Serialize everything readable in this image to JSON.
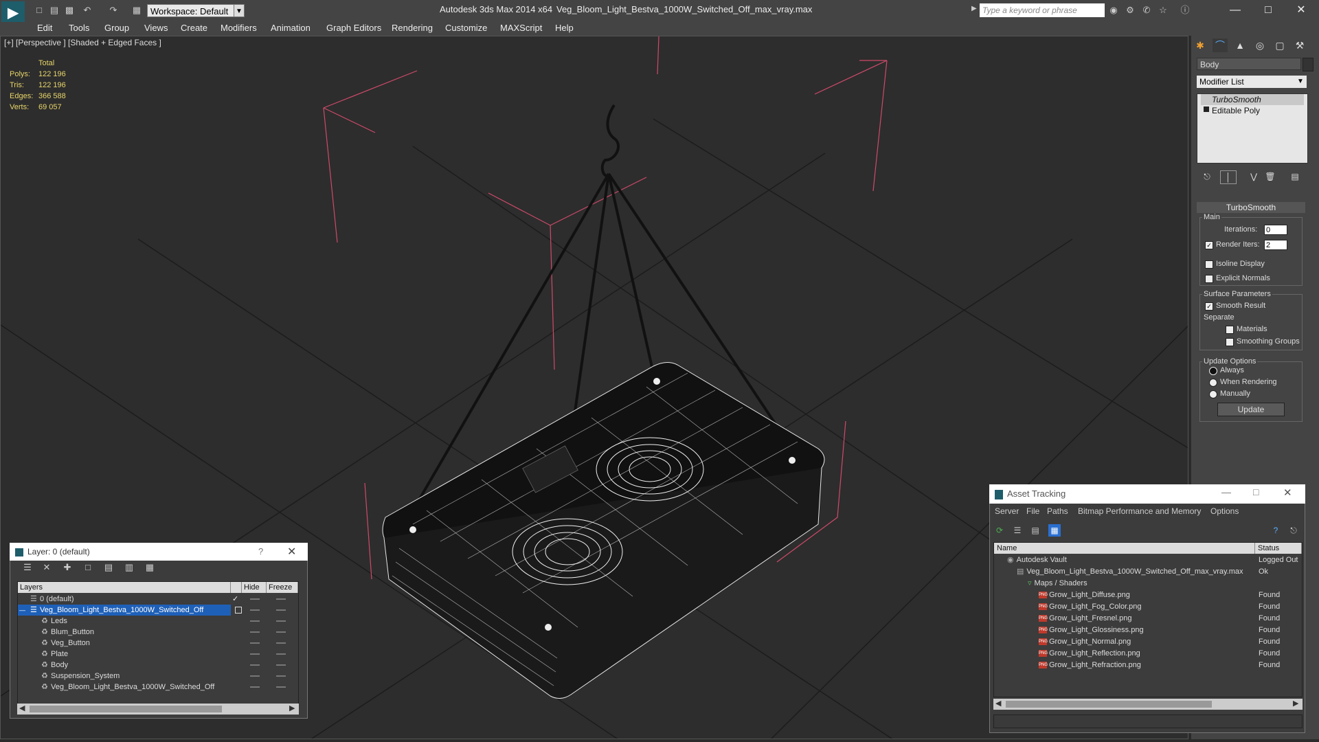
{
  "titlebar": {
    "app_title": "Autodesk 3ds Max  2014 x64",
    "file_title": "Veg_Bloom_Light_Bestva_1000W_Switched_Off_max_vray.max",
    "workspace": "Workspace: Default",
    "search_placeholder": "Type a keyword or phrase"
  },
  "menu": [
    "Edit",
    "Tools",
    "Group",
    "Views",
    "Create",
    "Modifiers",
    "Animation",
    "Graph Editors",
    "Rendering",
    "Customize",
    "MAXScript",
    "Help"
  ],
  "viewport": {
    "label": "[+] [Perspective ] [Shaded + Edged Faces ]",
    "stats": {
      "header": "Total",
      "rows": [
        {
          "label": "Polys:",
          "value": "122 196"
        },
        {
          "label": "Tris:",
          "value": "122 196"
        },
        {
          "label": "Edges:",
          "value": "366 588"
        },
        {
          "label": "Verts:",
          "value": "69 057"
        }
      ]
    }
  },
  "command_panel": {
    "object_name": "Body",
    "modifier_list": "Modifier List",
    "stack": [
      "TurboSmooth",
      "Editable Poly"
    ],
    "turbosmooth": {
      "title": "TurboSmooth",
      "main": "Main",
      "iterations_label": "Iterations:",
      "iterations_value": "0",
      "render_iters_label": "Render Iters:",
      "render_iters_value": "2",
      "isoline": "Isoline Display",
      "explicit_normals": "Explicit Normals",
      "surface_params": "Surface Parameters",
      "smooth_result": "Smooth Result",
      "separate": "Separate",
      "materials": "Materials",
      "smoothing_groups": "Smoothing Groups",
      "update_options": "Update Options",
      "always": "Always",
      "when_rendering": "When Rendering",
      "manually": "Manually",
      "update": "Update"
    }
  },
  "layer_dialog": {
    "title": "Layer: 0 (default)",
    "help": "?",
    "columns": [
      "Layers",
      "Hide",
      "Freeze"
    ],
    "rows": [
      {
        "name": "0 (default)"
      },
      {
        "name": "Veg_Bloom_Light_Bestva_1000W_Switched_Off"
      },
      {
        "name": "Leds"
      },
      {
        "name": "Blum_Button"
      },
      {
        "name": "Veg_Button"
      },
      {
        "name": "Plate"
      },
      {
        "name": "Body"
      },
      {
        "name": "Suspension_System"
      },
      {
        "name": "Veg_Bloom_Light_Bestva_1000W_Switched_Off"
      }
    ]
  },
  "asset_tracking": {
    "title": "Asset Tracking",
    "menu": [
      "Server",
      "File",
      "Paths",
      "Bitmap Performance and Memory",
      "Options"
    ],
    "columns": [
      "Name",
      "Status"
    ],
    "rows": [
      {
        "name": "Autodesk Vault",
        "status": "Logged Out"
      },
      {
        "name": "Veg_Bloom_Light_Bestva_1000W_Switched_Off_max_vray.max",
        "status": "Ok"
      },
      {
        "name": "Maps / Shaders",
        "status": ""
      },
      {
        "name": "Grow_Light_Diffuse.png",
        "status": "Found"
      },
      {
        "name": "Grow_Light_Fog_Color.png",
        "status": "Found"
      },
      {
        "name": "Grow_Light_Fresnel.png",
        "status": "Found"
      },
      {
        "name": "Grow_Light_Glossiness.png",
        "status": "Found"
      },
      {
        "name": "Grow_Light_Normal.png",
        "status": "Found"
      },
      {
        "name": "Grow_Light_Reflection.png",
        "status": "Found"
      },
      {
        "name": "Grow_Light_Refraction.png",
        "status": "Found"
      }
    ]
  }
}
